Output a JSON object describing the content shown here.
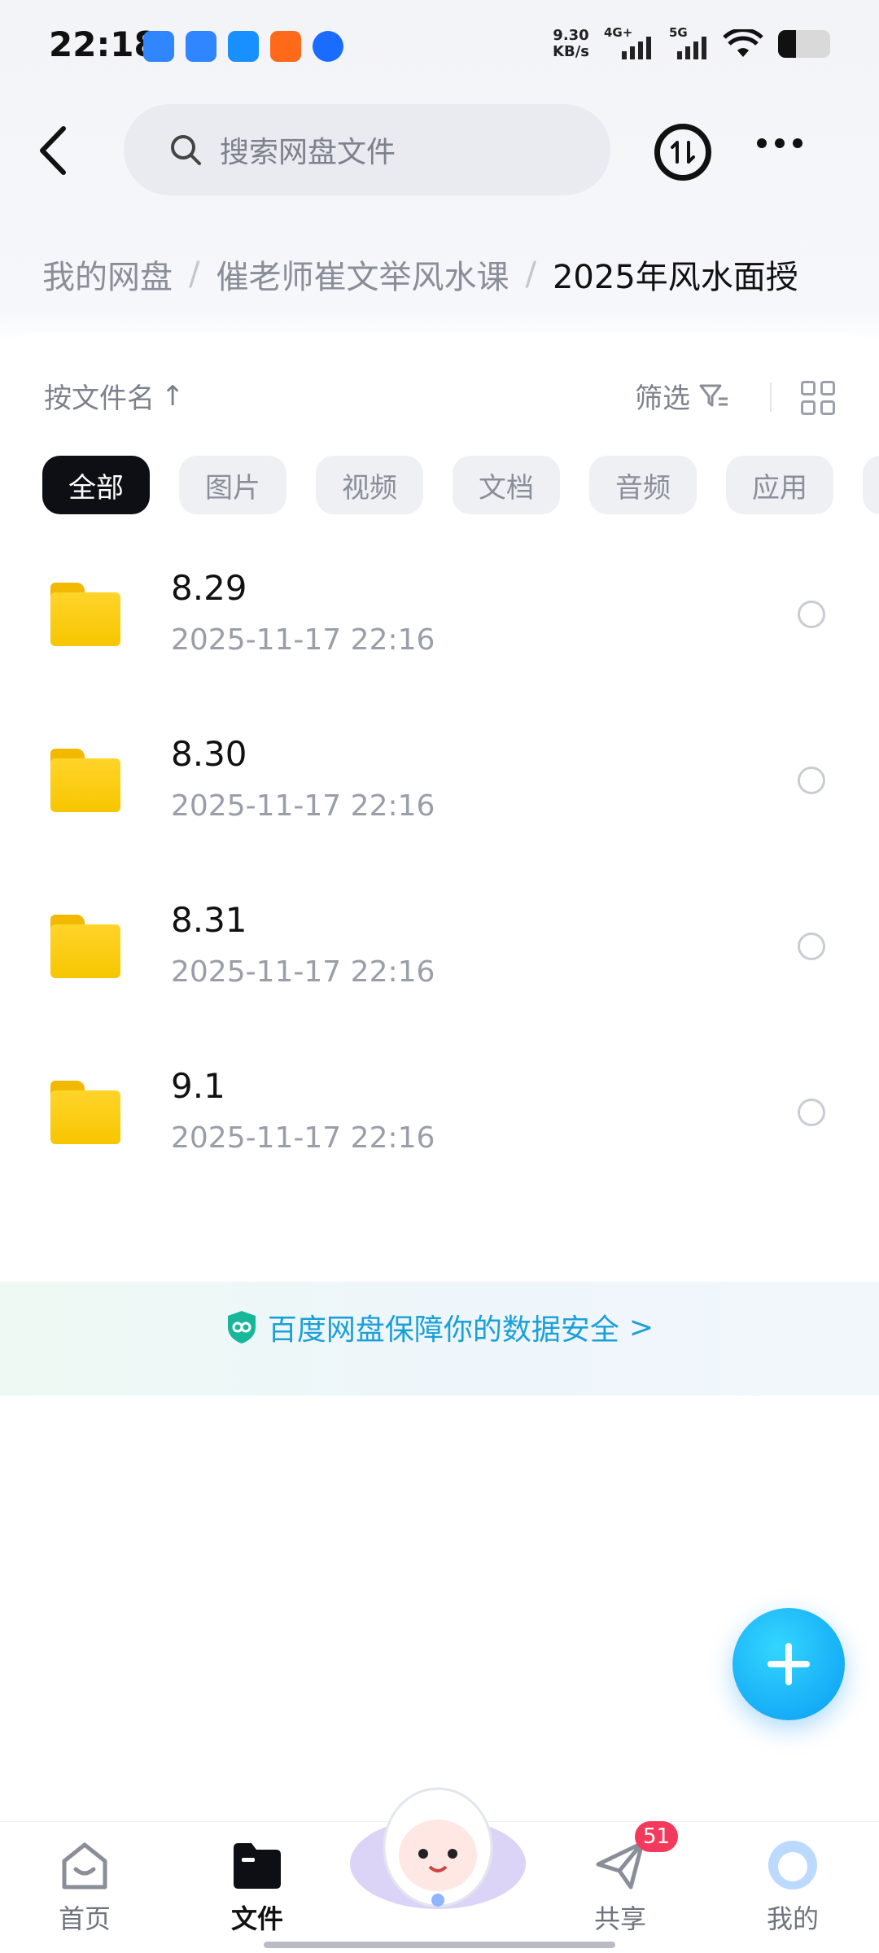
{
  "status_bar": {
    "time": "22:18",
    "net_speed_value": "9.30",
    "net_speed_unit": "KB/s",
    "sim1_label": "4G+",
    "sim2_label": "5G",
    "notification_icons": [
      "app-icon-blue",
      "app-icon-browser",
      "app-icon-chat",
      "app-icon-phone",
      "app-icon-circle"
    ]
  },
  "header": {
    "search_placeholder": "搜索网盘文件"
  },
  "breadcrumb": {
    "items": [
      "我的网盘",
      "催老师崔文举风水课"
    ],
    "separator": "/",
    "current": "2025年风水面授"
  },
  "toolbar": {
    "sort_label": "按文件名",
    "sort_arrow": "↑",
    "filter_label": "筛选"
  },
  "chips": [
    "全部",
    "图片",
    "视频",
    "文档",
    "音频",
    "应用"
  ],
  "files": [
    {
      "name": "8.29",
      "date": "2025-11-17  22:16"
    },
    {
      "name": "8.30",
      "date": "2025-11-17  22:16"
    },
    {
      "name": "8.31",
      "date": "2025-11-17  22:16"
    },
    {
      "name": "9.1",
      "date": "2025-11-17  22:16"
    }
  ],
  "security_banner": {
    "text": "百度网盘保障你的数据安全",
    "chevron": ">"
  },
  "bottom_nav": {
    "items": [
      "首页",
      "文件",
      "共享",
      "我的"
    ],
    "active": "文件",
    "share_badge": "51"
  },
  "colors": {
    "accent": "#1aa0d8",
    "fab": "#0a9cf3",
    "folder": "#ffd42a",
    "badge": "#f43a5c",
    "active_chip": "#0d0f15"
  }
}
